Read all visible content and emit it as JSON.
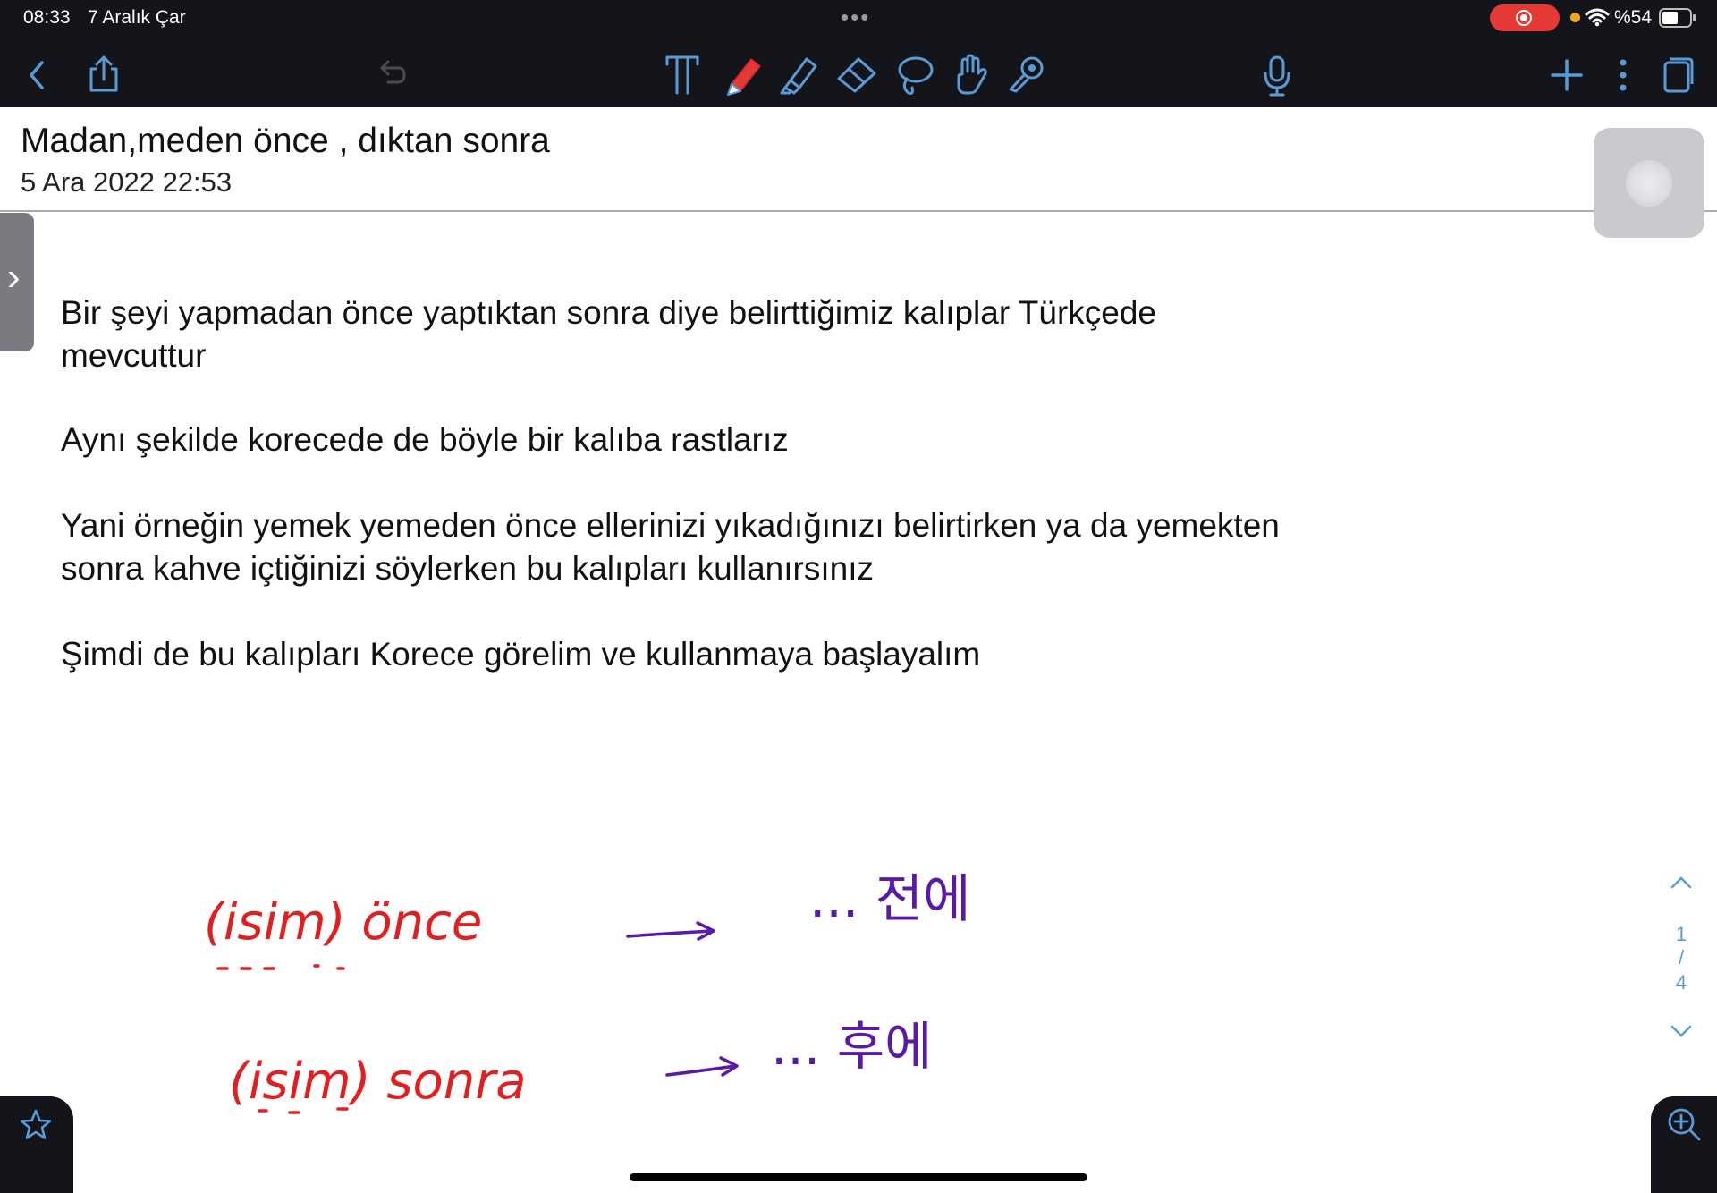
{
  "status_bar": {
    "time": "08:33",
    "date": "7 Aralık Çar",
    "battery": "%54",
    "recording_color": "#e53935"
  },
  "toolbar": {
    "icons": [
      "back-icon",
      "share-icon",
      "undo-icon",
      "text-tool-icon",
      "pen-icon",
      "highlighter-icon",
      "eraser-icon",
      "lasso-icon",
      "hand-icon",
      "laser-pointer-icon",
      "microphone-icon",
      "add-icon",
      "more-icon",
      "pages-icon"
    ],
    "pen_color": "#e53935",
    "tool_color": "#5b9bd5"
  },
  "document": {
    "title": "Madan,meden önce , dıktan sonra",
    "date": "5 Ara 2022 22:53",
    "paragraphs": [
      {
        "line1": "Bir şeyi yapmadan önce yaptıktan sonra diye belirttiğimiz kalıplar Türkçede",
        "line2": "mevcuttur"
      },
      {
        "line1": "Aynı şekilde korecede de böyle bir kalıba rastlarız",
        "line2": ""
      },
      {
        "line1": "Yani örneğin yemek yemeden önce ellerinizi yıkadığınızı belirtirken ya da yemekten",
        "line2": "sonra kahve içtiğinizi söylerken bu kalıpları kullanırsınız"
      },
      {
        "line1": "Şimdi de bu kalıpları Korece görelim ve kullanmaya başlayalım",
        "line2": ""
      }
    ]
  },
  "handwriting": {
    "row1": {
      "left": "(isim) önce",
      "right": "... 전에"
    },
    "row2": {
      "left": "(isim) sonra",
      "right": "... 후에"
    },
    "red": "#e02020",
    "purple": "#5a1aa8"
  },
  "page_indicator": {
    "current": "1",
    "separator": "/",
    "total": "4"
  }
}
